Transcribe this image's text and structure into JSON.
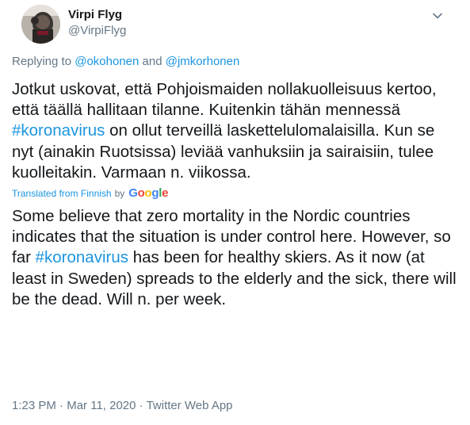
{
  "author": {
    "display_name": "Virpi Flyg",
    "handle": "@VirpiFlyg"
  },
  "reply": {
    "prefix": "Replying to",
    "mention_1": "@okohonen",
    "joiner": "and",
    "mention_2": "@jmkorhonen"
  },
  "tweet_fi": {
    "part1": "Jotkut uskovat, että Pohjoismaiden nollakuolleisuus kertoo, että täällä hallitaan tilanne. Kuitenkin tähän mennessä ",
    "hashtag": "#koronavirus",
    "part2": " on ollut terveillä laskettelulomalaisilla. Kun se nyt (ainakin Ruotsissa) leviää vanhuksiin ja sairaisiin, tulee kuolleitakin. Varmaan n. viikossa."
  },
  "translation": {
    "label": "Translated from Finnish",
    "by": "by",
    "provider": "Google",
    "google_colors": [
      "#4285F4",
      "#EA4335",
      "#FBBC05",
      "#4285F4",
      "#34A853",
      "#EA4335"
    ]
  },
  "tweet_en": {
    "part1": "Some believe that zero mortality in the Nordic countries indicates that the situation is under control here. However, so far ",
    "hashtag": "#koronavirus",
    "part2": " has been for healthy skiers. As it now (at least in Sweden) spreads to the elderly and the sick, there will be the dead. Will n. per week."
  },
  "meta": {
    "time": "1:23 PM",
    "separator": "·",
    "date": "Mar 11, 2020",
    "source": "Twitter Web App"
  },
  "colors": {
    "link": "#1b95e0",
    "secondary": "#657786",
    "text": "#14171a"
  },
  "icons": {
    "avatar": "profile-photo",
    "caret": "chevron-down-icon",
    "google": "google-logo"
  }
}
